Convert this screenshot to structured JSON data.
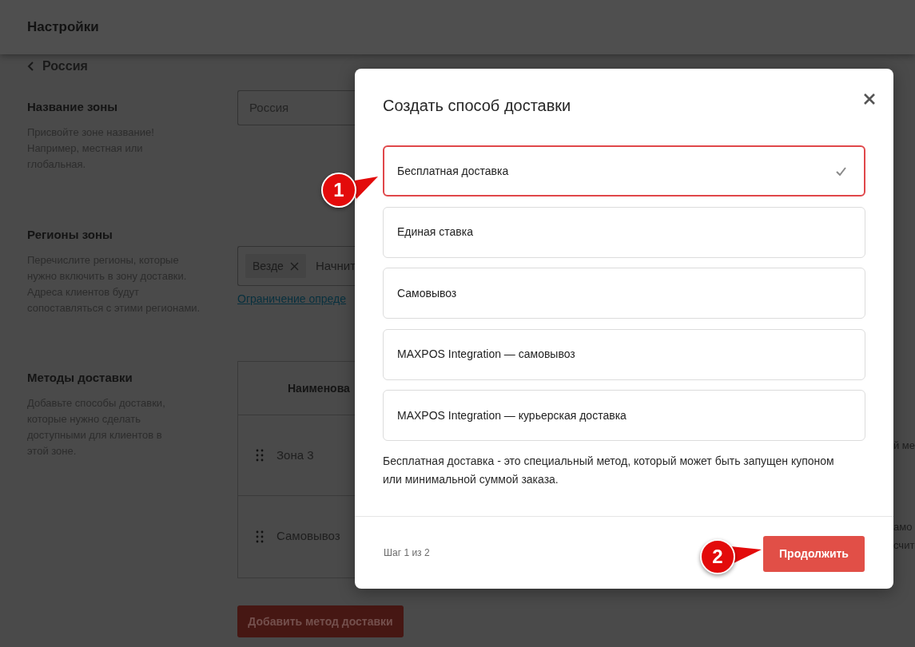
{
  "header": {
    "title": "Настройки"
  },
  "back_link": {
    "label": "Россия"
  },
  "sections": [
    {
      "kind": "name",
      "title": "Название зоны",
      "description": "Присвойте зоне название! Например, местная или глобальная.",
      "field": {
        "value": "Россия"
      }
    },
    {
      "kind": "regions",
      "title": "Регионы зоны",
      "description": "Перечислите регионы, которые нужно включить в зону доставки. Адреса клиентов будут сопоставляться с этими регионами.",
      "field": {
        "tags": [
          {
            "label": "Везде"
          }
        ],
        "placeholder": "Начнит"
      },
      "link": "Ограничение опреде"
    },
    {
      "kind": "methods",
      "title": "Методы доставки",
      "description": "Добавьте способы доставки, которые нужно сделать доступными для клиентов в этой зоне.",
      "table": {
        "columns": [
          "Наименова"
        ],
        "rows": [
          {
            "name": "Зона 3",
            "column_3": [
              "й ме"
            ]
          },
          {
            "name": "Самовывоз",
            "column_3": [
              "амо",
              "счит"
            ]
          }
        ]
      },
      "add_button": "Добавить метод доставки"
    }
  ],
  "modal": {
    "title": "Создать способ доставки",
    "options": [
      {
        "label": "Бесплатная доставка",
        "selected": true
      },
      {
        "label": "Единая ставка",
        "selected": false
      },
      {
        "label": "Самовывоз",
        "selected": false
      },
      {
        "label": "MAXPOS Integration — самовывоз",
        "selected": false
      },
      {
        "label": "MAXPOS Integration — курьерская доставка",
        "selected": false
      }
    ],
    "description": "Бесплатная доставка - это специальный метод, который может быть запущен купоном или минимальной суммой заказа.",
    "step": "Шаг 1 из 2",
    "continue_button": "Продолжить"
  },
  "callouts": [
    {
      "label": "1"
    },
    {
      "label": "2"
    }
  ]
}
